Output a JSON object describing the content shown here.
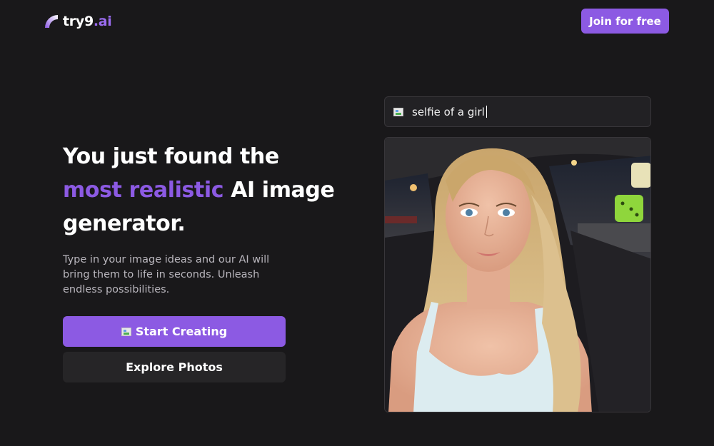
{
  "header": {
    "logo_main": "try9",
    "logo_suffix": ".ai",
    "join_label": "Join for free"
  },
  "hero": {
    "headline_part1": "You just found the",
    "headline_highlight": "most realistic",
    "headline_part2": "AI image generator.",
    "subtext": "Type in your image ideas and our AI will bring them to life in seconds. Unleash endless possibilities.",
    "start_label": "Start Creating",
    "explore_label": "Explore Photos"
  },
  "prompt": {
    "text": "selfie of a girl"
  },
  "colors": {
    "background": "#19181a",
    "accent": "#8c5ae3",
    "secondary_button": "#262527",
    "muted_text": "#b9b6bd"
  },
  "icons": {
    "logo_mark": "quarter-circle-gradient-icon",
    "start_button_icon": "broken-image-icon",
    "prompt_icon": "broken-image-icon"
  }
}
